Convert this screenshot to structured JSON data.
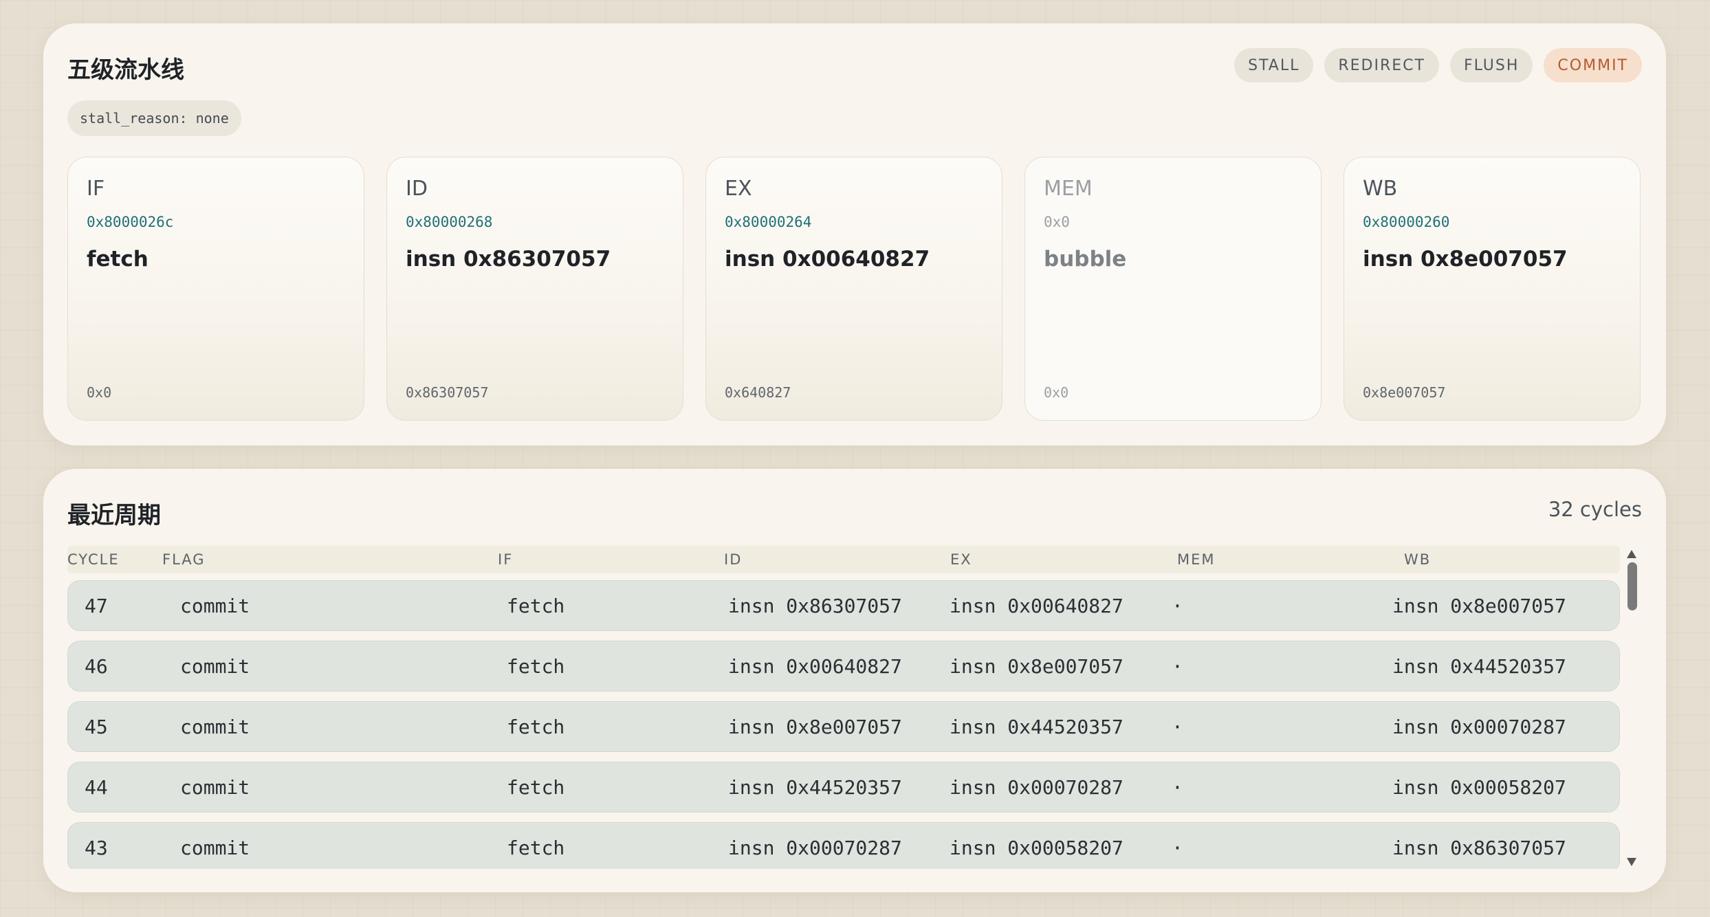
{
  "pipeline": {
    "title": "五级流水线",
    "flags": [
      {
        "label": "STALL",
        "active": false
      },
      {
        "label": "REDIRECT",
        "active": false
      },
      {
        "label": "FLUSH",
        "active": false
      },
      {
        "label": "COMMIT",
        "active": true
      }
    ],
    "stall_reason": "stall_reason: none",
    "stages": [
      {
        "name": "IF",
        "pc": "0x8000026c",
        "op": "fetch",
        "raw": "0x0",
        "bubble": false
      },
      {
        "name": "ID",
        "pc": "0x80000268",
        "op": "insn 0x86307057",
        "raw": "0x86307057",
        "bubble": false
      },
      {
        "name": "EX",
        "pc": "0x80000264",
        "op": "insn 0x00640827",
        "raw": "0x640827",
        "bubble": false
      },
      {
        "name": "MEM",
        "pc": "0x0",
        "op": "bubble",
        "raw": "0x0",
        "bubble": true
      },
      {
        "name": "WB",
        "pc": "0x80000260",
        "op": "insn 0x8e007057",
        "raw": "0x8e007057",
        "bubble": false
      }
    ]
  },
  "history": {
    "title": "最近周期",
    "count": "32 cycles",
    "columns": [
      "CYCLE",
      "FLAG",
      "IF",
      "ID",
      "EX",
      "MEM",
      "WB"
    ],
    "rows": [
      {
        "cycle": "47",
        "flag": "commit",
        "if": "fetch",
        "id": "insn 0x86307057",
        "ex": "insn 0x00640827",
        "mem": "·",
        "wb": "insn 0x8e007057"
      },
      {
        "cycle": "46",
        "flag": "commit",
        "if": "fetch",
        "id": "insn 0x00640827",
        "ex": "insn 0x8e007057",
        "mem": "·",
        "wb": "insn 0x44520357"
      },
      {
        "cycle": "45",
        "flag": "commit",
        "if": "fetch",
        "id": "insn 0x8e007057",
        "ex": "insn 0x44520357",
        "mem": "·",
        "wb": "insn 0x00070287"
      },
      {
        "cycle": "44",
        "flag": "commit",
        "if": "fetch",
        "id": "insn 0x44520357",
        "ex": "insn 0x00070287",
        "mem": "·",
        "wb": "insn 0x00058207"
      },
      {
        "cycle": "43",
        "flag": "commit",
        "if": "fetch",
        "id": "insn 0x00070287",
        "ex": "insn 0x00058207",
        "mem": "·",
        "wb": "insn 0x86307057"
      }
    ]
  },
  "colors": {
    "accent_active": "#b55a2e",
    "pc_text": "#1f6f77",
    "row_bg": "#dfe4de"
  }
}
